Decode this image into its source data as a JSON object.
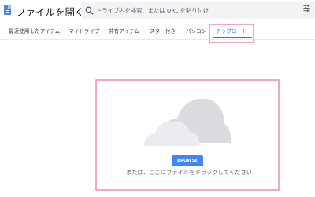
{
  "header": {
    "title": "ファイルを開く",
    "search_placeholder": "ドライブ内を検索、または URL を貼り付け"
  },
  "tabs": [
    {
      "label": "最近使用したアイテム"
    },
    {
      "label": "マイドライブ"
    },
    {
      "label": "共有アイテム"
    },
    {
      "label": "スター付き"
    },
    {
      "label": "パソコン"
    },
    {
      "label": "アップロード",
      "active": true
    }
  ],
  "upload": {
    "browse_label": "BROWSE",
    "drop_text": "または、ここにファイルをドラッグしてください"
  },
  "colors": {
    "accent": "#1a73e8",
    "button": "#4285f4",
    "highlight": "#f0a6c8",
    "cloud_back": "#dadce0",
    "cloud_front": "#ebecef"
  }
}
